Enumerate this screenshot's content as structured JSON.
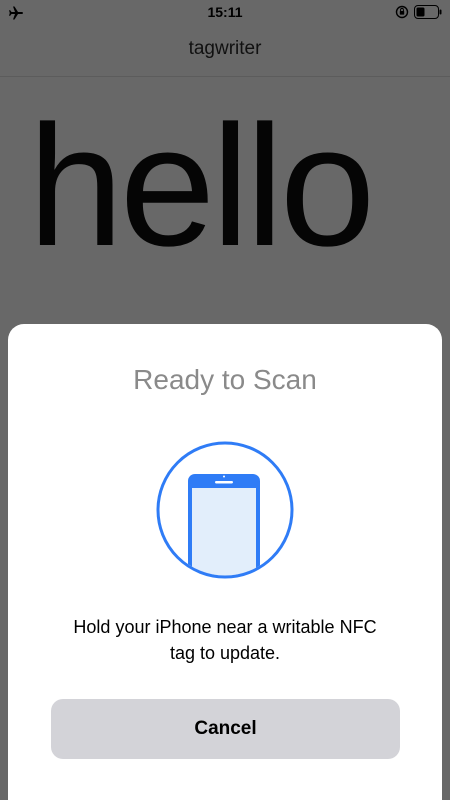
{
  "status_bar": {
    "time": "15:11",
    "airplane_icon": "airplane-icon",
    "orientation_icon": "orientation-lock-icon",
    "battery_icon": "battery-icon"
  },
  "nav": {
    "title": "tagwriter"
  },
  "content": {
    "text": "hello"
  },
  "scan_sheet": {
    "title": "Ready to Scan",
    "illustration_icon": "phone-scan-icon",
    "message_line1": "Hold your iPhone near a writable NFC",
    "message_line2": "tag to update.",
    "cancel_label": "Cancel"
  },
  "colors": {
    "accent": "#2f7cf6",
    "dimmed_background": "#686868",
    "sheet_background": "#ffffff",
    "button_background": "#d3d3d8"
  }
}
